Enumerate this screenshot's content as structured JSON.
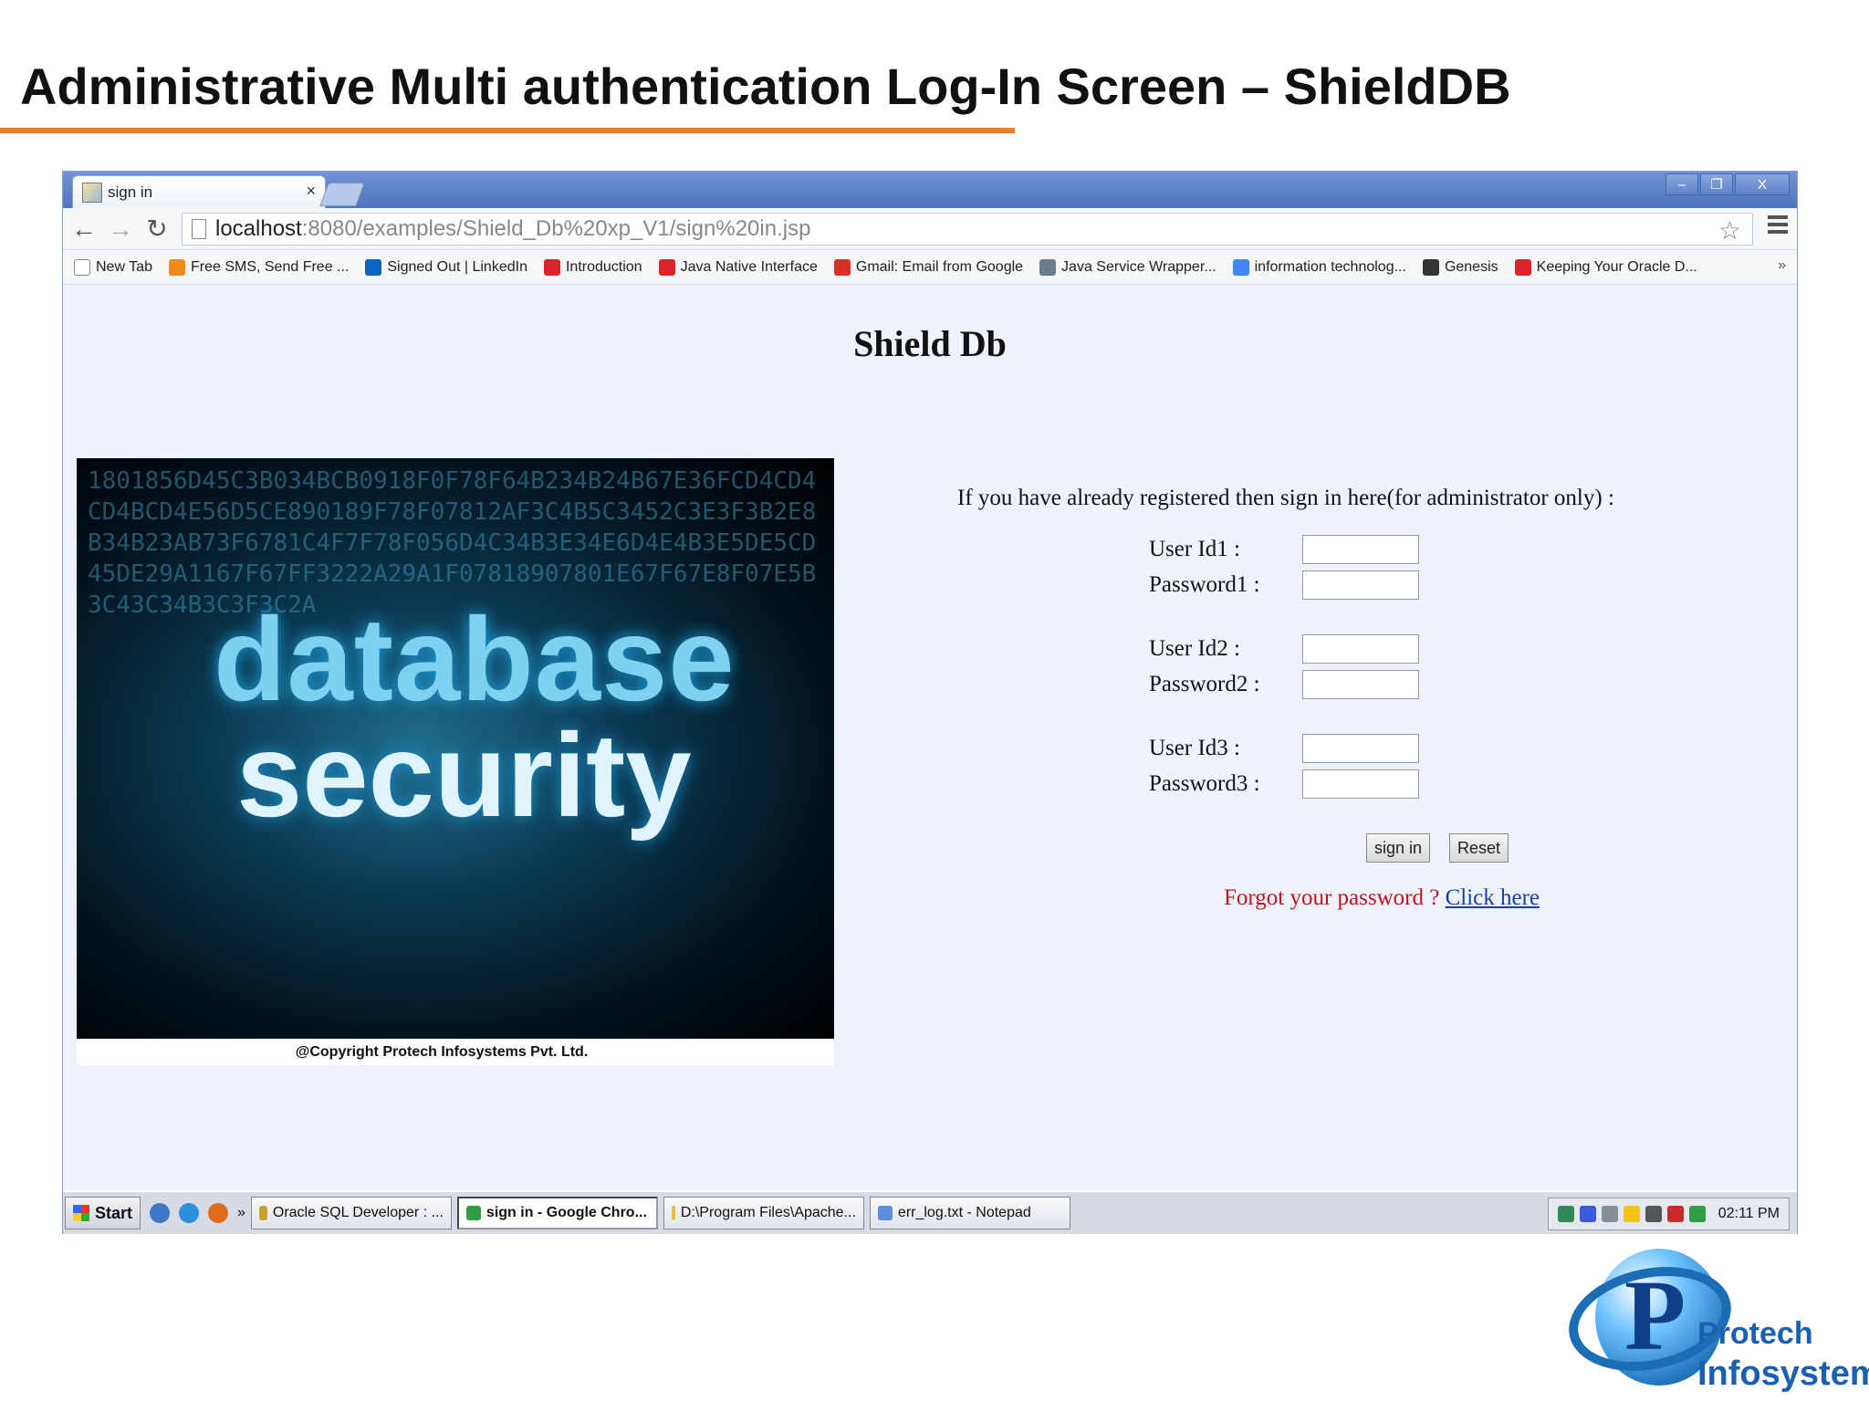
{
  "slide": {
    "title": "Administrative Multi authentication Log-In Screen – ShieldDB",
    "accent_color": "#ee7a22"
  },
  "browser": {
    "tab_title": "sign in",
    "tab_close": "×",
    "window_controls": [
      "–",
      "❐",
      "X"
    ],
    "url_host": "localhost",
    "url_rest": ":8080/examples/Shield_Db%20xp_V1/sign%20in.jsp",
    "bookmarks": [
      {
        "label": "New Tab",
        "icon": "page-icon",
        "color": "#ffffff"
      },
      {
        "label": "Free SMS, Send Free ...",
        "icon": "sms-icon",
        "color": "#f28b1e"
      },
      {
        "label": "Signed Out | LinkedIn",
        "icon": "linkedin-icon",
        "color": "#0a66c2"
      },
      {
        "label": "Introduction",
        "icon": "oracle-icon",
        "color": "#d9262b"
      },
      {
        "label": "Java Native Interface",
        "icon": "oracle-icon",
        "color": "#d9262b"
      },
      {
        "label": "Gmail: Email from Google",
        "icon": "gmail-icon",
        "color": "#d93025"
      },
      {
        "label": "Java Service Wrapper...",
        "icon": "globe-icon",
        "color": "#6b7c8f"
      },
      {
        "label": "information technolog...",
        "icon": "google-icon",
        "color": "#4285f4"
      },
      {
        "label": "Genesis",
        "icon": "genesis-icon",
        "color": "#333333"
      },
      {
        "label": "Keeping Your Oracle D...",
        "icon": "oracle-icon",
        "color": "#d9262b"
      }
    ],
    "bookmarks_more": "»"
  },
  "page": {
    "heading": "Shield Db",
    "hero": {
      "line1": "database",
      "line2": "security",
      "copyright": "@Copyright Protech Infosystems Pvt. Ltd."
    },
    "intro": "If you have already registered then sign in here(for administrator only) :",
    "fields": [
      {
        "label": "User Id1 :",
        "value": ""
      },
      {
        "label": "Password1 :",
        "value": ""
      },
      {
        "label": "User Id2 :",
        "value": ""
      },
      {
        "label": "Password2 :",
        "value": ""
      },
      {
        "label": "User Id3 :",
        "value": ""
      },
      {
        "label": "Password3 :",
        "value": ""
      }
    ],
    "sign_in_label": "sign in",
    "reset_label": "Reset",
    "forgot_text": "Forgot your password ?",
    "click_here": "Click here"
  },
  "taskbar": {
    "start_label": "Start",
    "chevron": "»",
    "tasks": [
      {
        "label": "Oracle SQL Developer : ...",
        "color": "#c8a030"
      },
      {
        "label": "sign in - Google Chro...",
        "color": "#2f9e44"
      },
      {
        "label": "D:\\Program Files\\Apache...",
        "color": "#e8c14a"
      },
      {
        "label": "err_log.txt - Notepad",
        "color": "#5b8ed6"
      }
    ],
    "clock": "02:11 PM"
  },
  "logo": {
    "line1": "Protech",
    "line2": "Infosystems"
  }
}
